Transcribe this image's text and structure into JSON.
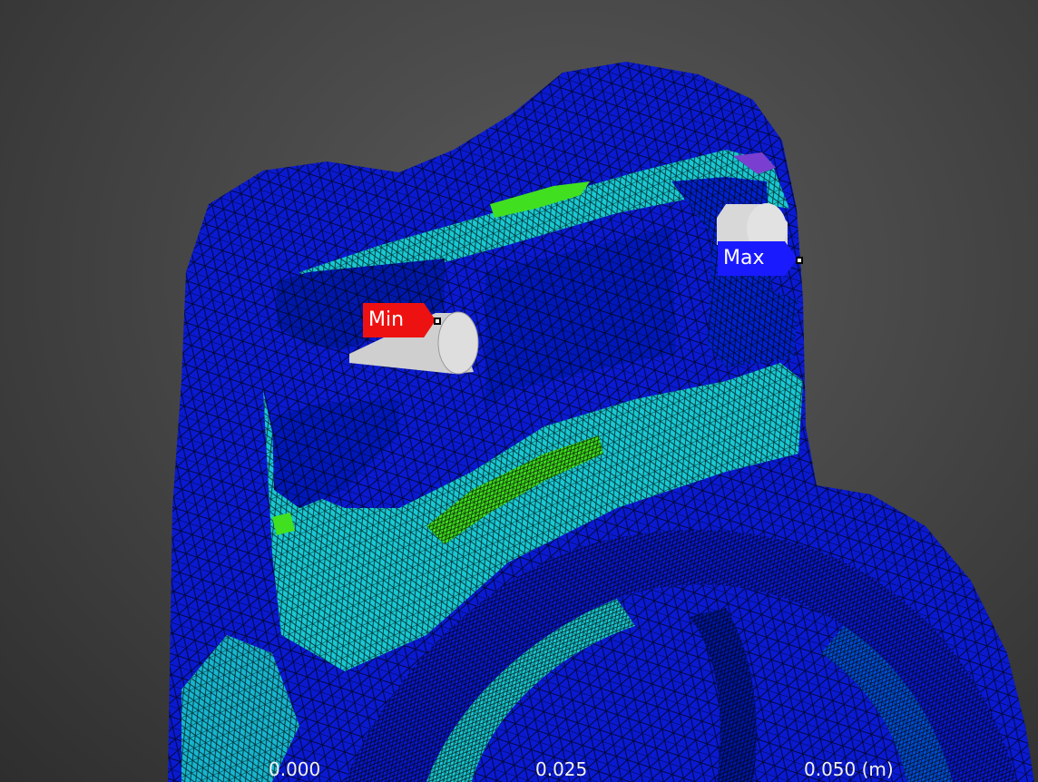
{
  "probes": {
    "min": {
      "label": "Min",
      "color": "#ee1111"
    },
    "max": {
      "label": "Max",
      "color": "#1a1aff"
    }
  },
  "scale_bar": {
    "ticks": [
      "0.000",
      "0.025",
      "0.050 (m)"
    ]
  },
  "colors": {
    "background": "#474747",
    "mesh_blue": "#0a1ad0",
    "mesh_mid_blue": "#0050d8",
    "mesh_cyan": "#19c8d2",
    "mesh_green": "#40e020",
    "mesh_line": "#000000",
    "pin_gray": "#d8d8d8"
  }
}
